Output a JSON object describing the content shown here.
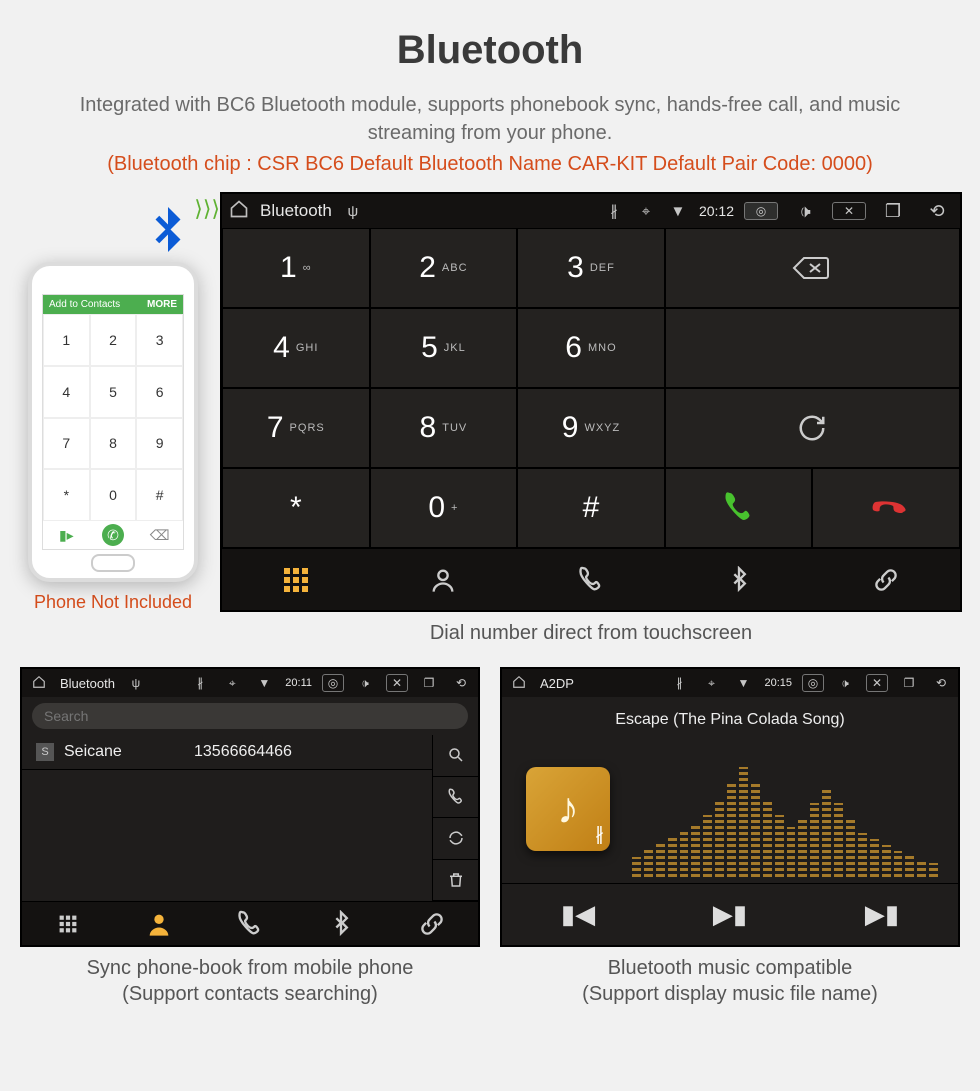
{
  "header": {
    "title": "Bluetooth",
    "subtitle": "Integrated with BC6 Bluetooth module, supports phonebook sync, hands-free call, and music streaming from your phone.",
    "specs": "(Bluetooth chip : CSR BC6     Default Bluetooth Name CAR-KIT     Default Pair Code: 0000)"
  },
  "phone_mock": {
    "top_bar_left": "Add to Contacts",
    "top_bar_right": "MORE",
    "keypad": [
      "1",
      "2",
      "3",
      "4",
      "5",
      "6",
      "7",
      "8",
      "9",
      "*",
      "0",
      "#"
    ],
    "caption": "Phone Not Included"
  },
  "dialer": {
    "status": {
      "title": "Bluetooth",
      "time": "20:12"
    },
    "keys": [
      {
        "d": "1",
        "l": "∞"
      },
      {
        "d": "2",
        "l": "ABC"
      },
      {
        "d": "3",
        "l": "DEF"
      },
      {
        "d": "4",
        "l": "GHI"
      },
      {
        "d": "5",
        "l": "JKL"
      },
      {
        "d": "6",
        "l": "MNO"
      },
      {
        "d": "7",
        "l": "PQRS"
      },
      {
        "d": "8",
        "l": "TUV"
      },
      {
        "d": "9",
        "l": "WXYZ"
      },
      {
        "d": "*",
        "l": ""
      },
      {
        "d": "0",
        "l": "+"
      },
      {
        "d": "#",
        "l": ""
      }
    ],
    "caption": "Dial number direct from touchscreen"
  },
  "phonebook": {
    "status": {
      "title": "Bluetooth",
      "time": "20:11"
    },
    "search_placeholder": "Search",
    "contact": {
      "tag": "S",
      "name": "Seicane",
      "number": "13566664466"
    },
    "caption_l1": "Sync phone-book from mobile phone",
    "caption_l2": "(Support contacts searching)"
  },
  "a2dp": {
    "status": {
      "title": "A2DP",
      "time": "20:15"
    },
    "song": "Escape (The Pina Colada Song)",
    "eq_heights": [
      20,
      28,
      34,
      40,
      46,
      54,
      62,
      78,
      96,
      110,
      96,
      78,
      62,
      50,
      60,
      74,
      88,
      74,
      58,
      44,
      38,
      32,
      26,
      22,
      18,
      14
    ],
    "caption_l1": "Bluetooth music compatible",
    "caption_l2": "(Support display music file name)"
  }
}
